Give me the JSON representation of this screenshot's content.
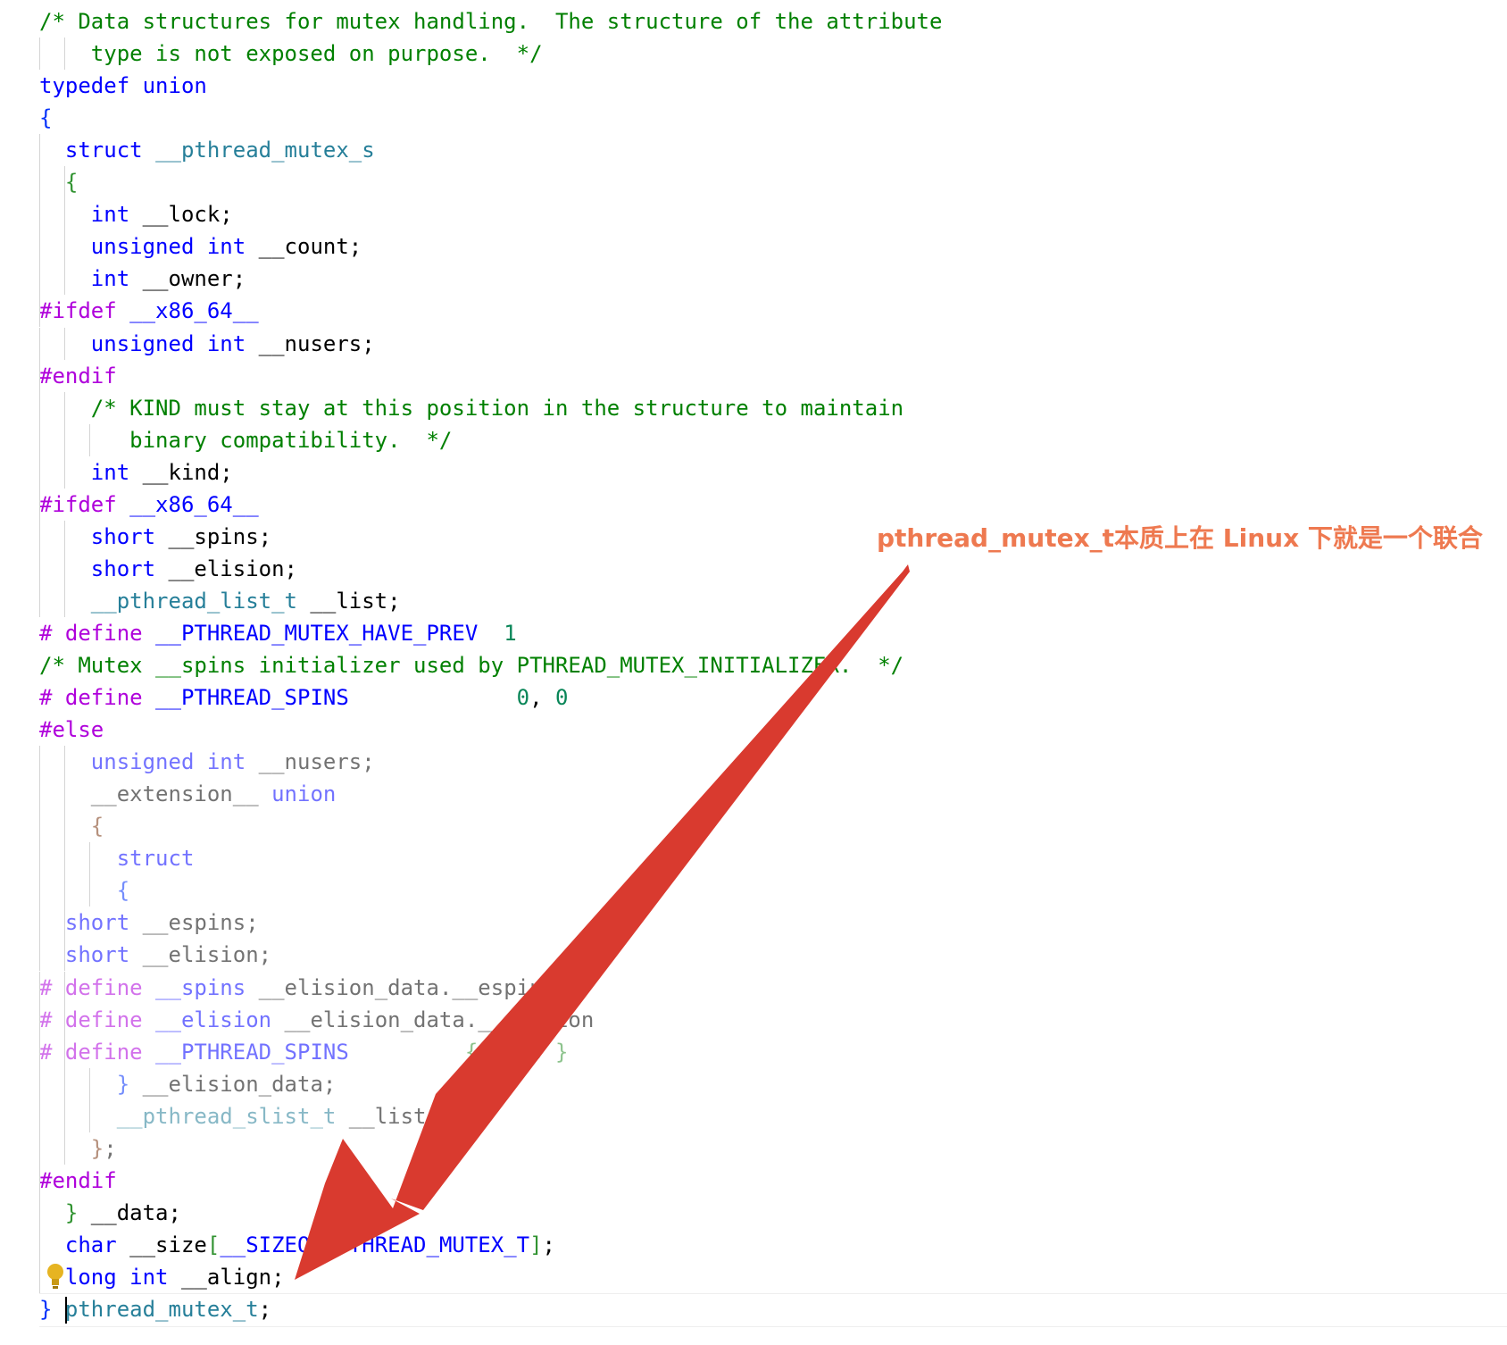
{
  "annotation": {
    "text": "pthread_mutex_t本质上在 Linux 下就是一个联合",
    "color": "#ee7950",
    "arrow_color": "#d93a2f"
  },
  "theme": {
    "keyword": "#0000ff",
    "type": "#267f99",
    "comment": "#008000",
    "preprocessor": "#af00db",
    "number": "#098658"
  },
  "code_lines": [
    {
      "indent": 0,
      "dim": false,
      "tokens": [
        [
          "cm",
          "/* Data structures for mutex handling.  The structure of the attribute"
        ]
      ]
    },
    {
      "indent": 0,
      "dim": false,
      "tokens": [
        [
          "cm",
          "    type is not exposed on purpose.  */"
        ]
      ]
    },
    {
      "indent": 0,
      "dim": false,
      "tokens": [
        [
          "kw",
          "typedef"
        ],
        [
          "id",
          " "
        ],
        [
          "kw",
          "union"
        ]
      ]
    },
    {
      "indent": 0,
      "dim": false,
      "tokens": [
        [
          "br1",
          "{"
        ]
      ]
    },
    {
      "indent": 0,
      "dim": false,
      "tokens": [
        [
          "id",
          "  "
        ],
        [
          "kw",
          "struct"
        ],
        [
          "id",
          " "
        ],
        [
          "type",
          "__pthread_mutex_s"
        ]
      ]
    },
    {
      "indent": 0,
      "dim": false,
      "tokens": [
        [
          "id",
          "  "
        ],
        [
          "br2",
          "{"
        ]
      ]
    },
    {
      "indent": 0,
      "dim": false,
      "tokens": [
        [
          "id",
          "    "
        ],
        [
          "kw",
          "int"
        ],
        [
          "id",
          " __lock;"
        ]
      ]
    },
    {
      "indent": 0,
      "dim": false,
      "tokens": [
        [
          "id",
          "    "
        ],
        [
          "kw",
          "unsigned"
        ],
        [
          "id",
          " "
        ],
        [
          "kw",
          "int"
        ],
        [
          "id",
          " __count;"
        ]
      ]
    },
    {
      "indent": 0,
      "dim": false,
      "tokens": [
        [
          "id",
          "    "
        ],
        [
          "kw",
          "int"
        ],
        [
          "id",
          " __owner;"
        ]
      ]
    },
    {
      "indent": 0,
      "dim": false,
      "tokens": [
        [
          "pp",
          "#ifdef"
        ],
        [
          "id",
          " "
        ],
        [
          "mac",
          "__x86_64__"
        ]
      ]
    },
    {
      "indent": 0,
      "dim": false,
      "tokens": [
        [
          "id",
          "    "
        ],
        [
          "kw",
          "unsigned"
        ],
        [
          "id",
          " "
        ],
        [
          "kw",
          "int"
        ],
        [
          "id",
          " __nusers;"
        ]
      ]
    },
    {
      "indent": 0,
      "dim": false,
      "tokens": [
        [
          "pp",
          "#endif"
        ]
      ]
    },
    {
      "indent": 0,
      "dim": false,
      "tokens": [
        [
          "id",
          "    "
        ],
        [
          "cm",
          "/* KIND must stay at this position in the structure to maintain"
        ]
      ]
    },
    {
      "indent": 0,
      "dim": false,
      "tokens": [
        [
          "id",
          "    "
        ],
        [
          "cm",
          "   binary compatibility.  */"
        ]
      ]
    },
    {
      "indent": 0,
      "dim": false,
      "tokens": [
        [
          "id",
          "    "
        ],
        [
          "kw",
          "int"
        ],
        [
          "id",
          " __kind;"
        ]
      ]
    },
    {
      "indent": 0,
      "dim": false,
      "tokens": [
        [
          "pp",
          "#ifdef"
        ],
        [
          "id",
          " "
        ],
        [
          "mac",
          "__x86_64__"
        ]
      ]
    },
    {
      "indent": 0,
      "dim": false,
      "tokens": [
        [
          "id",
          "    "
        ],
        [
          "kw",
          "short"
        ],
        [
          "id",
          " __spins;"
        ]
      ]
    },
    {
      "indent": 0,
      "dim": false,
      "tokens": [
        [
          "id",
          "    "
        ],
        [
          "kw",
          "short"
        ],
        [
          "id",
          " __elision;"
        ]
      ]
    },
    {
      "indent": 0,
      "dim": false,
      "tokens": [
        [
          "id",
          "    "
        ],
        [
          "type",
          "__pthread_list_t"
        ],
        [
          "id",
          " __list;"
        ]
      ]
    },
    {
      "indent": 0,
      "dim": false,
      "tokens": [
        [
          "pp",
          "# define"
        ],
        [
          "id",
          " "
        ],
        [
          "mac",
          "__PTHREAD_MUTEX_HAVE_PREV"
        ],
        [
          "id",
          "  "
        ],
        [
          "num",
          "1"
        ]
      ]
    },
    {
      "indent": 0,
      "dim": false,
      "tokens": [
        [
          "cm",
          "/* Mutex __spins initializer used by PTHREAD_MUTEX_INITIALIZER.  */"
        ]
      ]
    },
    {
      "indent": 0,
      "dim": false,
      "tokens": [
        [
          "pp",
          "# define"
        ],
        [
          "id",
          " "
        ],
        [
          "mac",
          "__PTHREAD_SPINS"
        ],
        [
          "id",
          "             "
        ],
        [
          "num",
          "0"
        ],
        [
          "id",
          ", "
        ],
        [
          "num",
          "0"
        ]
      ]
    },
    {
      "indent": 0,
      "dim": false,
      "tokens": [
        [
          "pp",
          "#else"
        ]
      ]
    },
    {
      "indent": 0,
      "dim": true,
      "tokens": [
        [
          "id",
          "    "
        ],
        [
          "kw",
          "unsigned"
        ],
        [
          "id",
          " "
        ],
        [
          "kw",
          "int"
        ],
        [
          "id",
          " __nusers;"
        ]
      ]
    },
    {
      "indent": 0,
      "dim": true,
      "tokens": [
        [
          "id",
          "    __extension__ "
        ],
        [
          "kw",
          "union"
        ]
      ]
    },
    {
      "indent": 0,
      "dim": true,
      "tokens": [
        [
          "id",
          "    "
        ],
        [
          "br3",
          "{"
        ]
      ]
    },
    {
      "indent": 0,
      "dim": true,
      "tokens": [
        [
          "id",
          "      "
        ],
        [
          "kw",
          "struct"
        ]
      ]
    },
    {
      "indent": 0,
      "dim": true,
      "tokens": [
        [
          "id",
          "      "
        ],
        [
          "br1",
          "{"
        ]
      ]
    },
    {
      "indent": 0,
      "dim": true,
      "tokens": [
        [
          "id",
          "  "
        ],
        [
          "kw",
          "short"
        ],
        [
          "id",
          " __espins;"
        ]
      ]
    },
    {
      "indent": 0,
      "dim": true,
      "tokens": [
        [
          "id",
          "  "
        ],
        [
          "kw",
          "short"
        ],
        [
          "id",
          " __elision;"
        ]
      ]
    },
    {
      "indent": 0,
      "dim": true,
      "tokens": [
        [
          "pp",
          "# define"
        ],
        [
          "id",
          " "
        ],
        [
          "mac",
          "__spins"
        ],
        [
          "id",
          " __elision_data.__espins"
        ]
      ]
    },
    {
      "indent": 0,
      "dim": true,
      "tokens": [
        [
          "pp",
          "# define"
        ],
        [
          "id",
          " "
        ],
        [
          "mac",
          "__elision"
        ],
        [
          "id",
          " __elision_data.__elision"
        ]
      ]
    },
    {
      "indent": 0,
      "dim": true,
      "tokens": [
        [
          "pp",
          "# define"
        ],
        [
          "id",
          " "
        ],
        [
          "mac",
          "__PTHREAD_SPINS"
        ],
        [
          "id",
          "         "
        ],
        [
          "br2",
          "{ "
        ],
        [
          "num",
          "0"
        ],
        [
          "id",
          ", "
        ],
        [
          "num",
          "0"
        ],
        [
          "br2",
          " }"
        ]
      ]
    },
    {
      "indent": 0,
      "dim": true,
      "tokens": [
        [
          "id",
          "      "
        ],
        [
          "br1",
          "}"
        ],
        [
          "id",
          " __elision_data;"
        ]
      ]
    },
    {
      "indent": 0,
      "dim": true,
      "tokens": [
        [
          "id",
          "      "
        ],
        [
          "type",
          "__pthread_slist_t"
        ],
        [
          "id",
          " __list;"
        ]
      ]
    },
    {
      "indent": 0,
      "dim": true,
      "tokens": [
        [
          "id",
          "    "
        ],
        [
          "br3",
          "}"
        ],
        [
          "id",
          ";"
        ]
      ]
    },
    {
      "indent": 0,
      "dim": false,
      "tokens": [
        [
          "pp",
          "#endif"
        ]
      ]
    },
    {
      "indent": 0,
      "dim": false,
      "tokens": [
        [
          "id",
          "  "
        ],
        [
          "br2",
          "}"
        ],
        [
          "id",
          " __data;"
        ]
      ]
    },
    {
      "indent": 0,
      "dim": false,
      "tokens": [
        [
          "id",
          "  "
        ],
        [
          "kw",
          "char"
        ],
        [
          "id",
          " __size"
        ],
        [
          "br2",
          "["
        ],
        [
          "mac",
          "__SIZEOF_PTHREAD_MUTEX_T"
        ],
        [
          "br2",
          "]"
        ],
        [
          "id",
          ";"
        ]
      ]
    },
    {
      "indent": 0,
      "dim": false,
      "tokens": [
        [
          "id",
          "  "
        ],
        [
          "kw",
          "long"
        ],
        [
          "id",
          " "
        ],
        [
          "kw",
          "int"
        ],
        [
          "id",
          " __align;"
        ]
      ]
    },
    {
      "indent": 0,
      "dim": false,
      "tokens": [
        [
          "br1",
          "}"
        ],
        [
          "id",
          " "
        ],
        [
          "type",
          "pthread_mutex_t"
        ],
        [
          "id",
          ";"
        ]
      ]
    }
  ]
}
